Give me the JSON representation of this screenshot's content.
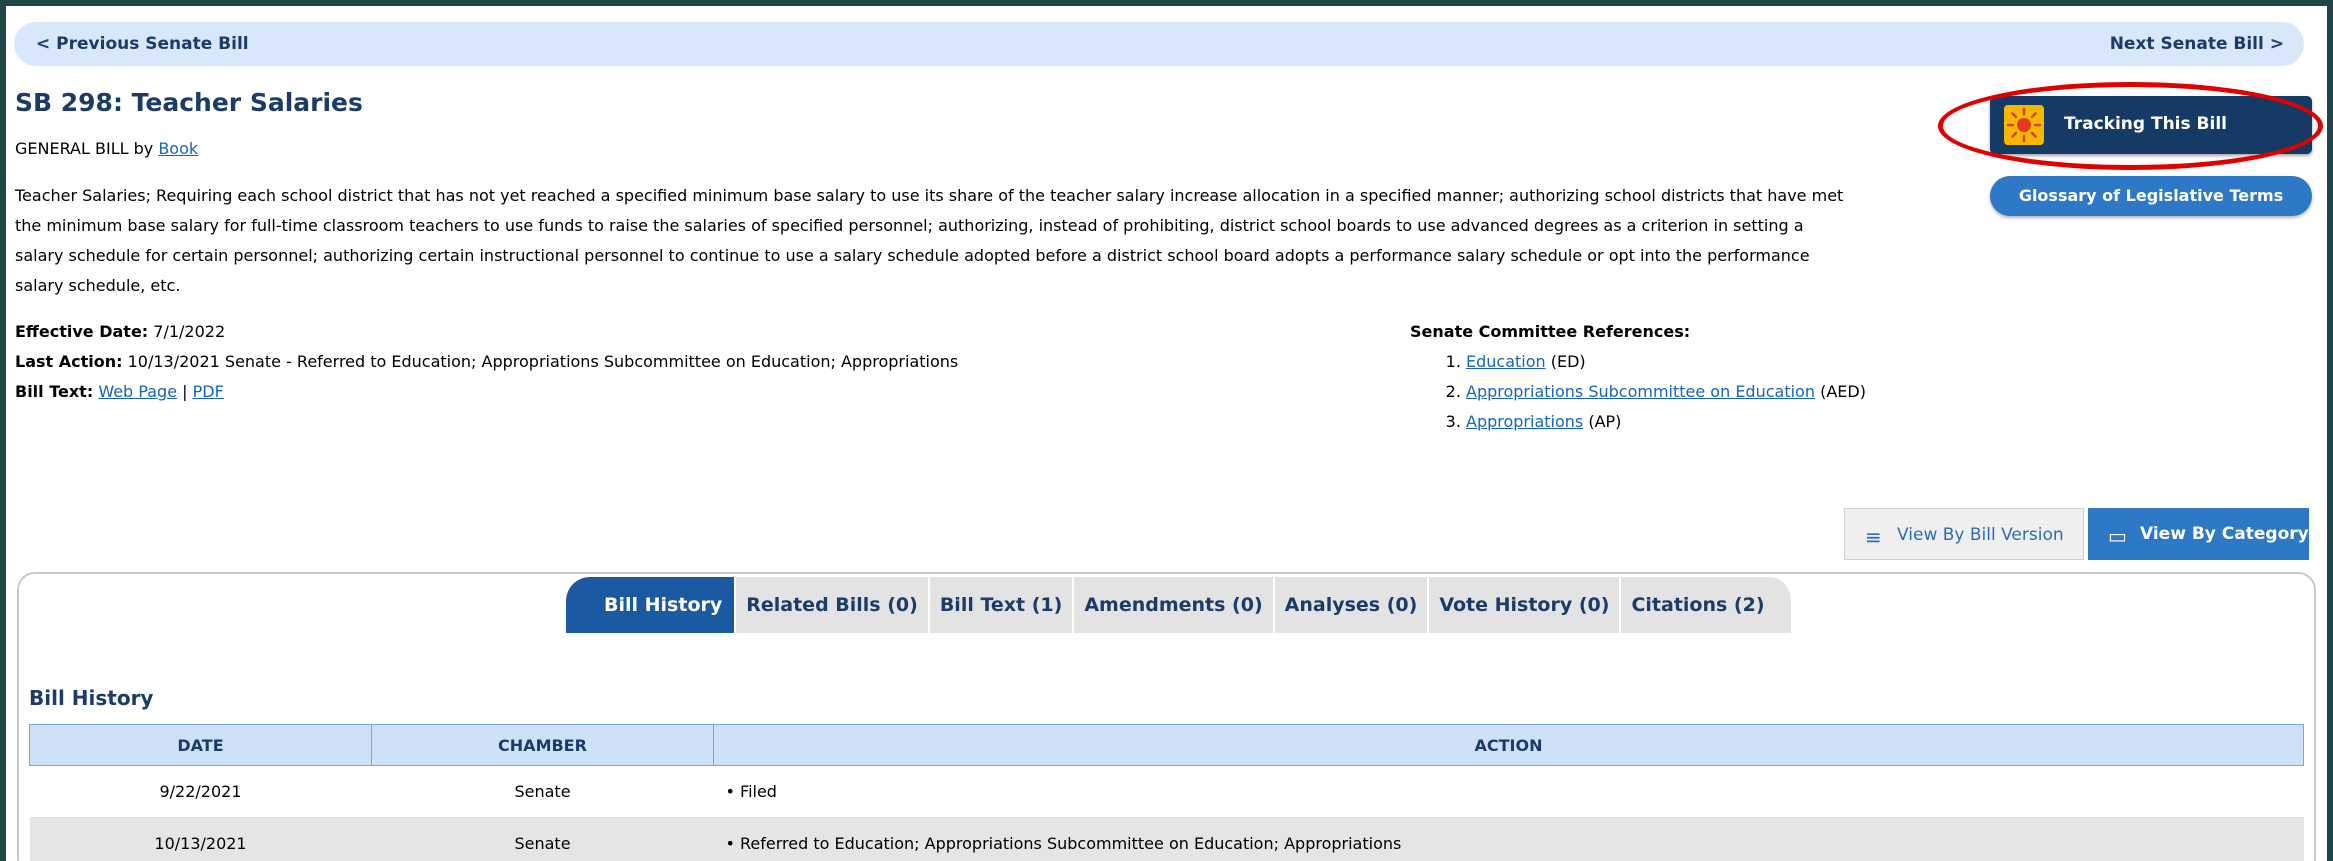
{
  "nav": {
    "prev_label": "< Previous Senate Bill",
    "next_label": "Next Senate Bill >"
  },
  "bill": {
    "title": "SB 298: Teacher Salaries",
    "sponsor_prefix": "GENERAL BILL by",
    "sponsor_name": "Book",
    "description": "Teacher Salaries; Requiring each school district that has not yet reached a specified minimum base salary to use its share of the teacher salary increase allocation in a specified manner; authorizing school districts that have met the minimum base salary for full-time classroom teachers to use funds to raise the salaries of specified personnel; authorizing, instead of prohibiting, district school boards to use advanced degrees as a criterion in setting a salary schedule for certain personnel; authorizing certain instructional personnel to continue to use a salary schedule adopted before a district school board adopts a performance salary schedule or opt into the performance salary schedule, etc.",
    "effective_label": "Effective Date:",
    "effective_value": "7/1/2022",
    "last_action_label": "Last Action:",
    "last_action_value": "10/13/2021 Senate - Referred to Education; Appropriations Subcommittee on Education; Appropriations",
    "bill_text_label": "Bill Text:",
    "web_page_link": "Web Page",
    "separator": "|",
    "pdf_link": "PDF"
  },
  "committees": {
    "heading": "Senate Committee References:",
    "items": [
      {
        "name": "Education",
        "code": "(ED)"
      },
      {
        "name": "Appropriations Subcommittee on Education",
        "code": "(AED)"
      },
      {
        "name": "Appropriations",
        "code": "(AP)"
      }
    ]
  },
  "actions": {
    "tracking_label": "Tracking This Bill",
    "glossary_label": "Glossary of Legislative Terms",
    "view_by_version_label": "View By Bill Version",
    "view_by_category_label": "View By Category"
  },
  "tabs": [
    {
      "label": "Bill History"
    },
    {
      "label": "Related Bills (0)"
    },
    {
      "label": "Bill Text (1)"
    },
    {
      "label": "Amendments (0)"
    },
    {
      "label": "Analyses (0)"
    },
    {
      "label": "Vote History (0)"
    },
    {
      "label": "Citations (2)"
    }
  ],
  "history": {
    "title": "Bill History",
    "columns": [
      "DATE",
      "CHAMBER",
      "ACTION"
    ],
    "rows": [
      {
        "date": "9/22/2021",
        "chamber": "Senate",
        "action": "• Filed"
      },
      {
        "date": "10/13/2021",
        "chamber": "Senate",
        "action": "• Referred to Education; Appropriations Subcommittee on Education; Appropriations"
      }
    ]
  },
  "colors": {
    "frame": "#1f4548",
    "heading": "#1b3c68",
    "accent": "#2e78c8",
    "highlight": "#e00000"
  }
}
